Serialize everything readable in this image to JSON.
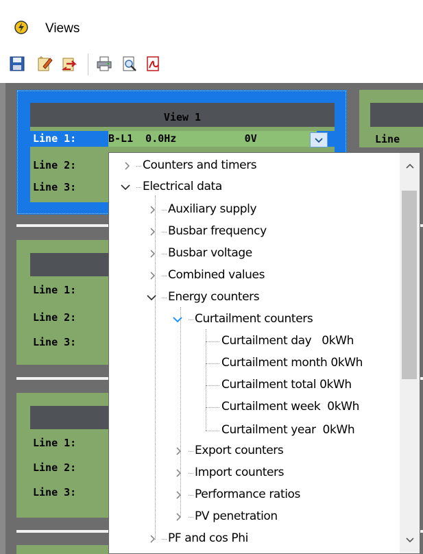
{
  "window": {
    "title": "Views"
  },
  "toolbar": {
    "buttons": [
      {
        "icon": "save-icon"
      },
      {
        "icon": "edit-icon"
      },
      {
        "icon": "swap-icon"
      },
      {
        "icon": "print-icon"
      },
      {
        "icon": "print-preview-icon"
      },
      {
        "icon": "pdf-icon"
      }
    ]
  },
  "views": {
    "view1": {
      "title": "View 1",
      "line1_label": "Line 1:",
      "line1_value": "B-L1  0.0Hz           0V",
      "line2_label": "Line 2:",
      "line3_label": "Line 3:"
    },
    "view2": {
      "line1_label": "Line 1:",
      "line2_label": "Line 2:",
      "line3_label": "Line 3:"
    },
    "view3": {
      "line1_label": "Line 1:",
      "line2_label": "Line 2:",
      "line3_label": "Line 3:"
    },
    "view_right": {
      "line1_label": "Line "
    }
  },
  "tree": {
    "counters_timers": "Counters and timers",
    "electrical_data": "Electrical data",
    "auxiliary_supply": "Auxiliary supply",
    "busbar_frequency": "Busbar frequency",
    "busbar_voltage": "Busbar voltage",
    "combined_values": "Combined values",
    "energy_counters": "Energy counters",
    "curtailment_counters": "Curtailment counters",
    "curt_day": "Curtailment day   0kWh",
    "curt_month": "Curtailment month 0kWh",
    "curt_total": "Curtailment total 0kWh",
    "curt_week": "Curtailment week  0kWh",
    "curt_year": "Curtailment year  0kWh",
    "export_counters": "Export counters",
    "import_counters": "Import counters",
    "performance_ratios": "Performance ratios",
    "pv_penetration": "PV penetration",
    "pf_cos_phi": "PF and cos Phi"
  },
  "colors": {
    "panel_green": "#83a86a",
    "panel_header": "#4f5358",
    "selection_blue": "#1879e6",
    "canvas_gray": "#6d6d6d",
    "tree_expander_active": "#1e90ff"
  }
}
